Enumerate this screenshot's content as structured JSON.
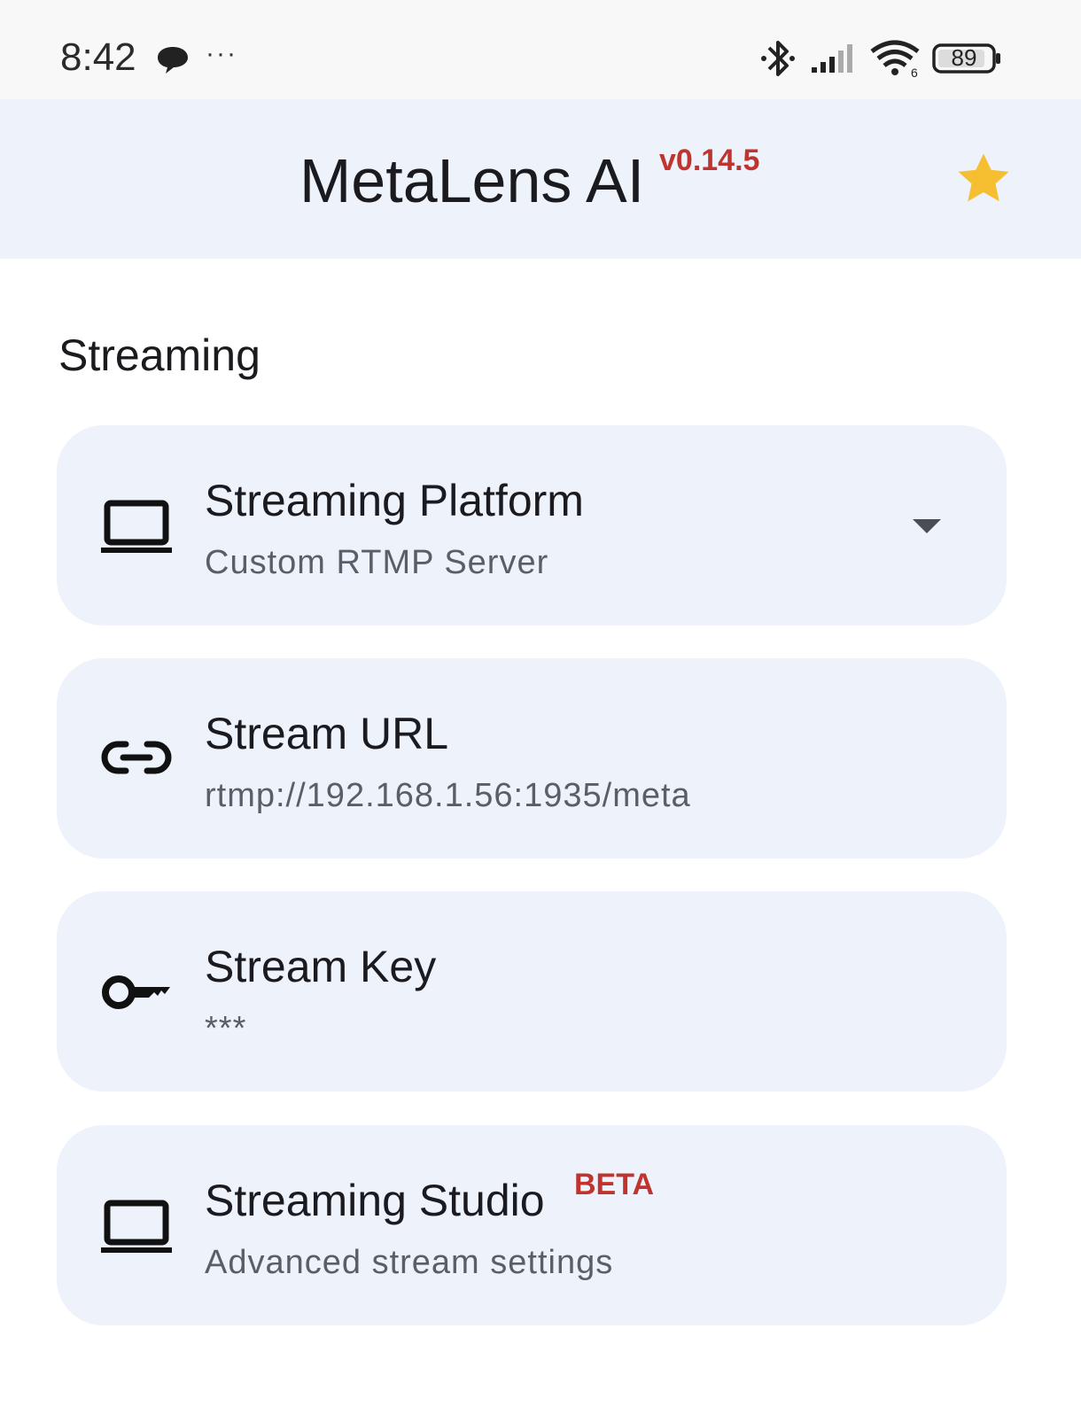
{
  "status_bar": {
    "time": "8:42",
    "more": "···",
    "battery": "89",
    "icons": [
      "chat-icon",
      "bluetooth-icon",
      "signal-icon",
      "wifi-icon",
      "battery-icon"
    ]
  },
  "app_bar": {
    "title": "MetaLens AI",
    "version": "v0.14.5",
    "star_icon": "star-icon"
  },
  "section": {
    "title": "Streaming"
  },
  "cards": [
    {
      "title": "Streaming Platform",
      "subtitle": "Custom RTMP Server",
      "icon": "laptop-icon",
      "has_dropdown": true
    },
    {
      "title": "Stream URL",
      "subtitle": "rtmp://192.168.1.56:1935/meta",
      "icon": "link-icon"
    },
    {
      "title": "Stream Key",
      "subtitle": "***",
      "icon": "key-icon"
    },
    {
      "title": "Streaming Studio",
      "badge": "BETA",
      "subtitle": "Advanced stream settings",
      "icon": "laptop-icon"
    }
  ],
  "colors": {
    "app_bar_bg": "#edf2fb",
    "card_bg": "#edf2fb",
    "accent_red": "#c0342f",
    "star": "#f6bf32"
  }
}
